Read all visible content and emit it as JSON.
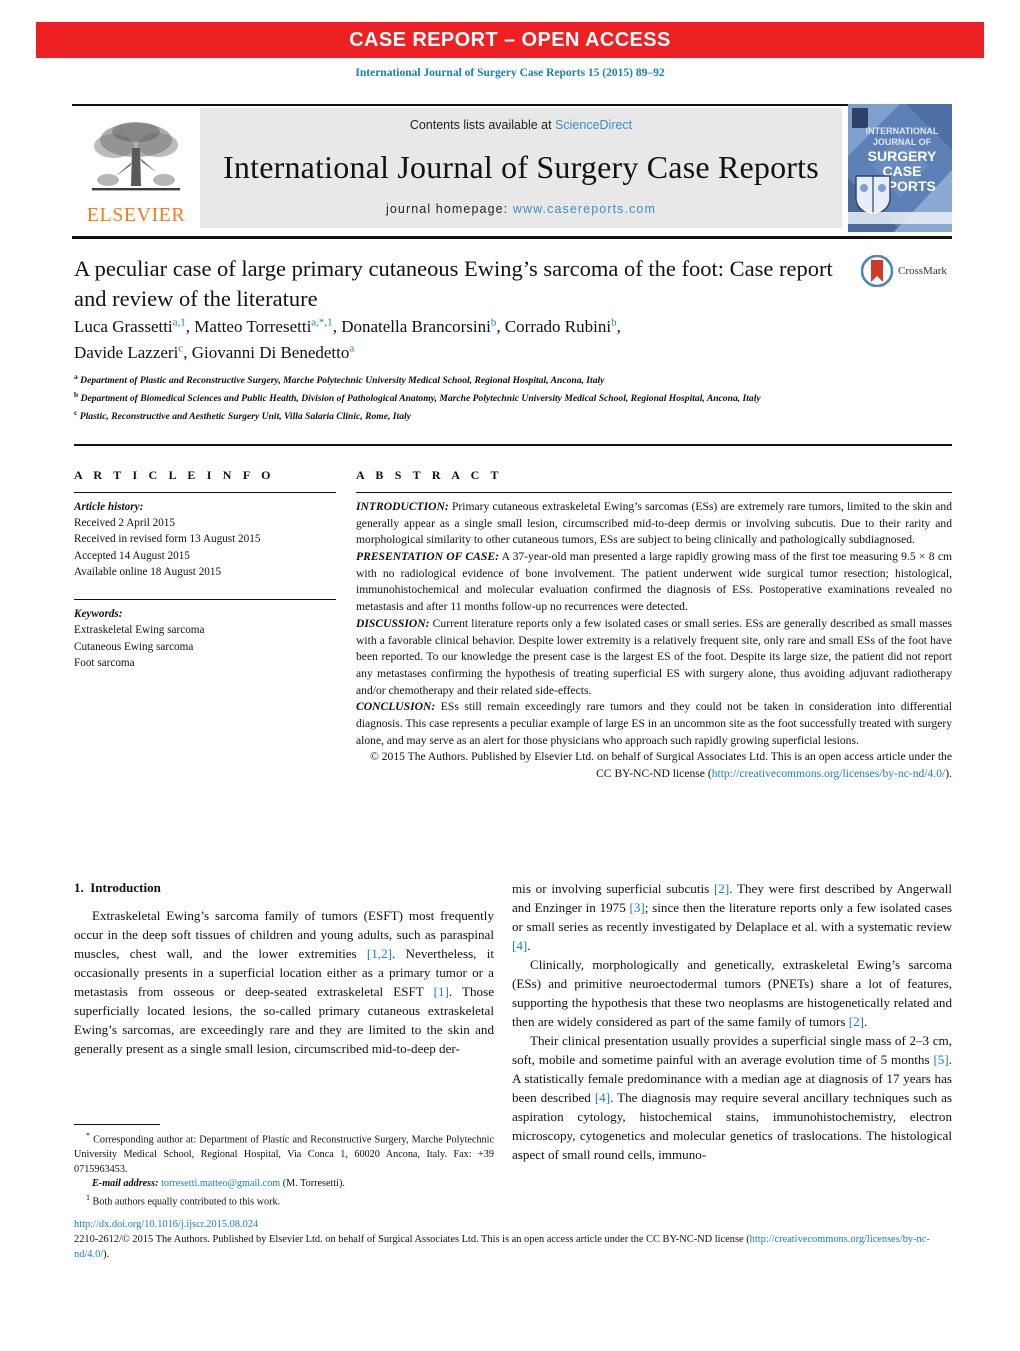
{
  "banner": {
    "text": "CASE REPORT – OPEN ACCESS",
    "color": "#ED2024"
  },
  "citation": "International Journal of Surgery Case Reports 15 (2015) 89–92",
  "masthead": {
    "publisher": "ELSEVIER",
    "contents_prefix": "Contents lists available at ",
    "contents_link": "ScienceDirect",
    "journal_title": "International Journal of Surgery Case Reports",
    "homepage_prefix": "journal homepage: ",
    "homepage_url": "www.casereports.com",
    "cover_lines": [
      "INTERNATIONAL",
      "JOURNAL OF",
      "SURGERY",
      "CASE",
      "REPORTS"
    ]
  },
  "article": {
    "title": "A peculiar case of large primary cutaneous Ewing’s sarcoma of the foot: Case report and review of the literature",
    "crossmark_label": "CrossMark",
    "authors": [
      {
        "name": "Luca Grassetti",
        "marks": "a,1"
      },
      {
        "name": "Matteo Torresetti",
        "marks": "a,*,1"
      },
      {
        "name": "Donatella Brancorsini",
        "marks": "b"
      },
      {
        "name": "Corrado Rubini",
        "marks": "b"
      },
      {
        "name": "Davide Lazzeri",
        "marks": "c"
      },
      {
        "name": "Giovanni Di Benedetto",
        "marks": "a"
      }
    ],
    "affiliations": [
      {
        "mark": "a",
        "text": "Department of Plastic and Reconstructive Surgery, Marche Polytechnic University Medical School, Regional Hospital, Ancona, Italy"
      },
      {
        "mark": "b",
        "text": "Department of Biomedical Sciences and Public Health, Division of Pathological Anatomy, Marche Polytechnic University Medical School, Regional Hospital, Ancona, Italy"
      },
      {
        "mark": "c",
        "text": "Plastic, Reconstructive and Aesthetic Surgery Unit, Villa Salaria Clinic, Rome, Italy"
      }
    ]
  },
  "article_info": {
    "heading": "A R T I C L E   I N F O",
    "history_label": "Article history:",
    "history": [
      "Received 2 April 2015",
      "Received in revised form 13 August 2015",
      "Accepted 14 August 2015",
      "Available online 18 August 2015"
    ],
    "keywords_label": "Keywords:",
    "keywords": [
      "Extraskeletal Ewing sarcoma",
      "Cutaneous Ewing sarcoma",
      "Foot sarcoma"
    ]
  },
  "abstract": {
    "heading": "A B S T R A C T",
    "sections": [
      {
        "label": "INTRODUCTION:",
        "text": " Primary cutaneous extraskeletal Ewing’s sarcomas (ESs) are extremely rare tumors, limited to the skin and generally appear as a single small lesion, circumscribed mid-to-deep dermis or involving subcutis. Due to their rarity and morphological similarity to other cutaneous tumors, ESs are subject to being clinically and pathologically subdiagnosed."
      },
      {
        "label": "PRESENTATION OF CASE:",
        "text": " A 37-year-old man presented a large rapidly growing mass of the first toe measuring 9.5 × 8 cm with no radiological evidence of bone involvement. The patient underwent wide surgical tumor resection; histological, immunohistochemical and molecular evaluation confirmed the diagnosis of ESs. Postoperative examinations revealed no metastasis and after 11 months follow-up no recurrences were detected."
      },
      {
        "label": "DISCUSSION:",
        "text": " Current literature reports only a few isolated cases or small series. ESs are generally described as small masses with a favorable clinical behavior. Despite lower extremity is a relatively frequent site, only rare and small ESs of the foot have been reported. To our knowledge the present case is the largest ES of the foot. Despite its large size, the patient did not report any metastases confirming the hypothesis of treating superficial ES with surgery alone, thus avoiding adjuvant radiotherapy and/or chemotherapy and their related side-effects."
      },
      {
        "label": "CONCLUSION:",
        "text": " ESs still remain exceedingly rare tumors and they could not be taken in consideration into differential diagnosis. This case represents a peculiar example of large ES in an uncommon site as the foot successfully treated with surgery alone, and may serve as an alert for those physicians who approach such rapidly growing superficial lesions."
      }
    ],
    "copyright_pre": "© 2015 The Authors. Published by Elsevier Ltd. on behalf of Surgical Associates Ltd. This is an open access article under the CC BY-NC-ND license (",
    "copyright_link": "http://creativecommons.org/licenses/by-nc-nd/4.0/",
    "copyright_post": ")."
  },
  "body": {
    "left": {
      "section_number": "1.",
      "section_title": "Introduction",
      "paragraph_1_a": "Extraskeletal Ewing’s sarcoma family of tumors (ESFT) most frequently occur in the deep soft tissues of children and young adults, such as paraspinal muscles, chest wall, and the lower extremities ",
      "ref_12": "[1,2]",
      "paragraph_1_b": ". Nevertheless, it occasionally presents in a superficial location either as a primary tumor or a metastasis from osseous or deep-seated extraskeletal ESFT ",
      "ref_1": "[1]",
      "paragraph_1_c": ". Those superficially located lesions, the so-called primary cutaneous extraskeletal Ewing’s sarcomas, are exceedingly rare and they are limited to the skin and generally present as a single small lesion, circumscribed mid-to-deep der-"
    },
    "right": {
      "paragraph_1_a": "mis or involving superficial subcutis ",
      "ref_2": "[2]",
      "paragraph_1_b": ". They were first described by Angerwall and Enzinger in 1975 ",
      "ref_3": "[3]",
      "paragraph_1_c": "; since then the literature reports only a few isolated cases or small series as recently investigated by Delaplace et al. with a systematic review ",
      "ref_4": "[4]",
      "paragraph_1_d": ".",
      "paragraph_2_a": "Clinically, morphologically and genetically, extraskeletal Ewing’s sarcoma (ESs) and primitive neuroectodermal tumors (PNETs) share a lot of features, supporting the hypothesis that these two neoplasms are histogenetically related and then are widely considered as part of the same family of tumors ",
      "ref_2b": "[2]",
      "paragraph_2_b": ".",
      "paragraph_3_a": "Their clinical presentation usually provides a superficial single mass of 2–3 cm, soft, mobile and sometime painful with an average evolution time of 5 months ",
      "ref_5": "[5]",
      "paragraph_3_b": ". A statistically female predominance with a median age at diagnosis of 17 years has been described ",
      "ref_4b": "[4]",
      "paragraph_3_c": ". The diagnosis may require several ancillary techniques such as aspiration cytology, histochemical stains, immunohistochemistry, electron microscopy, cytogenetics and molecular genetics of traslocations. The histological aspect of small round cells, immuno-"
    }
  },
  "footnotes": {
    "corresponding_mark": "*",
    "corresponding": " Corresponding author at: Department of Plastic and Reconstructive Surgery, Marche Polytechnic University Medical School, Regional Hospital, Via Conca 1, 60020 Ancona, Italy. Fax: +39 0715963453.",
    "email_label": "E-mail address:",
    "email": "torresetti.matteo@gmail.com",
    "email_owner": " (M. Torresetti).",
    "equal_mark": "1",
    "equal_contribution": " Both authors equally contributed to this work."
  },
  "footer": {
    "doi": "http://dx.doi.org/10.1016/j.ijscr.2015.08.024",
    "issn_line_pre": "2210-2612/© 2015 The Authors. Published by Elsevier Ltd. on behalf of Surgical Associates Ltd. This is an open access article under the CC BY-NC-ND license (",
    "issn_link": "http://creativecommons.org/licenses/by-nc-nd/4.0/",
    "issn_line_post": ")."
  }
}
